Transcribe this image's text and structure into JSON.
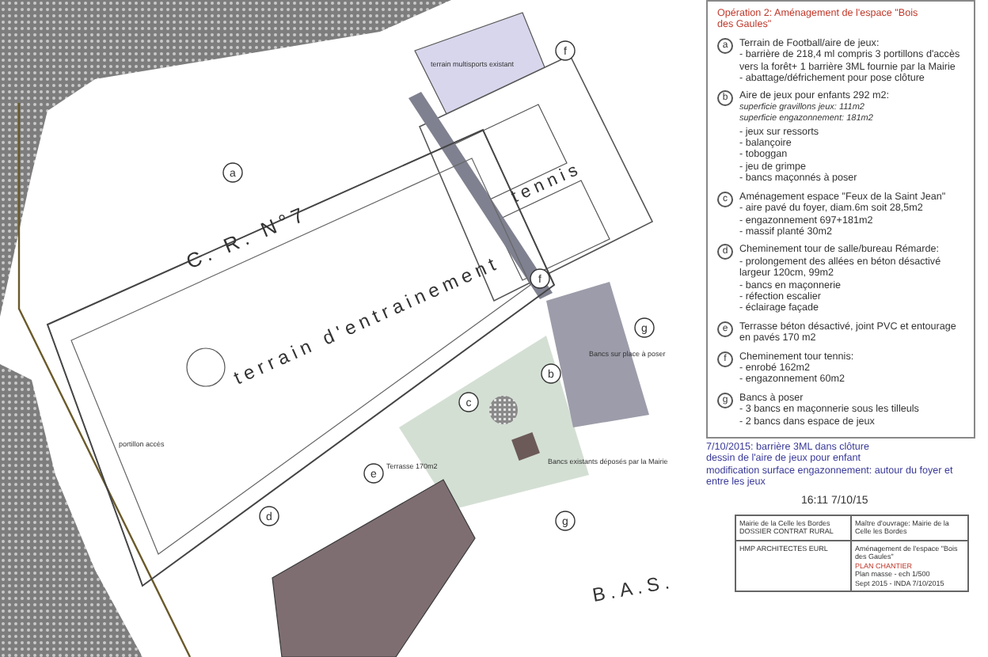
{
  "plan": {
    "labels": [
      {
        "text": "C. R. N°7",
        "kind": "road"
      },
      {
        "text": "terrain d'entrainement",
        "kind": "pitch"
      },
      {
        "text": "tennis",
        "kind": "court"
      },
      {
        "text": "B.A.S.",
        "kind": "street"
      }
    ],
    "notes": [
      "terrain multisports existant",
      "portillon accès",
      "Terrasse 170m2",
      "Bancs sur place à poser",
      "Bancs existants déposés par la Mairie"
    ],
    "markers": [
      "a",
      "f",
      "f",
      "b",
      "c",
      "d",
      "e",
      "g",
      "g"
    ]
  },
  "legend": {
    "title": "Opération 2: Aménagement de l'espace \"Bois des Gaules\"",
    "items": [
      {
        "letter": "a",
        "title": "Terrain de Football/aire de jeux:",
        "lines": [
          {
            "kind": "plain",
            "text": "- barrière de 218,4 ml compris 3 portillons d'accès vers la forêt+ 1 barrière 3ML fournie par la Mairie"
          },
          {
            "kind": "plain",
            "text": "- abattage/défrichement pour pose clôture"
          }
        ]
      },
      {
        "letter": "b",
        "title": "Aire de jeux pour enfants 292 m2:",
        "lines": [
          {
            "kind": "italic",
            "text": "superficie gravillons jeux: 111m2"
          },
          {
            "kind": "italic",
            "text": "superficie engazonnement: 181m2"
          },
          {
            "kind": "plain",
            "text": "- jeux sur ressorts"
          },
          {
            "kind": "plain",
            "text": "- balançoire"
          },
          {
            "kind": "plain",
            "text": "- toboggan"
          },
          {
            "kind": "plain",
            "text": "- jeu de grimpe"
          },
          {
            "kind": "plain",
            "text": "- bancs maçonnés à poser"
          }
        ]
      },
      {
        "letter": "c",
        "title": "Aménagement espace \"Feux de la Saint Jean\"",
        "lines": [
          {
            "kind": "plain",
            "text": "- aire pavé du foyer, diam.6m soit 28,5m2"
          },
          {
            "kind": "plain",
            "text": "- engazonnement 697+181m2"
          },
          {
            "kind": "plain",
            "text": "- massif planté 30m2"
          }
        ]
      },
      {
        "letter": "d",
        "title": "Cheminement tour de salle/bureau Rémarde:",
        "lines": [
          {
            "kind": "plain",
            "text": "- prolongement des allées en béton désactivé largeur 120cm, 99m2"
          },
          {
            "kind": "plain",
            "text": "- bancs en maçonnerie"
          },
          {
            "kind": "plain",
            "text": "- réfection escalier"
          },
          {
            "kind": "plain",
            "text": "- éclairage façade"
          }
        ]
      },
      {
        "letter": "e",
        "title": "Terrasse béton désactivé, joint PVC et entourage en pavés  170 m2"
      },
      {
        "letter": "f",
        "title": "Cheminement tour tennis:",
        "lines": [
          {
            "kind": "plain",
            "text": "- enrobé 162m2"
          },
          {
            "kind": "plain",
            "text": "- engazonnement 60m2"
          }
        ]
      },
      {
        "letter": "g",
        "title": "Bancs à poser",
        "lines": [
          {
            "kind": "plain",
            "text": "- 3 bancs en maçonnerie sous les tilleuls"
          },
          {
            "kind": "plain",
            "text": "- 2 bancs dans espace de jeux"
          }
        ]
      }
    ]
  },
  "revision": {
    "lines": [
      "7/10/2015: barrière 3ML dans clôture",
      "dessin de l'aire de jeux pour enfant",
      "modification surface engazonnement: autour du foyer et entre les jeux"
    ],
    "timestamp": "16:11 7/10/15"
  },
  "title_block": {
    "client": "Mairie de la Celle les Bordes",
    "file": "DOSSIER CONTRAT RURAL",
    "owner": "Maître d'ouvrage: Mairie de la Celle les Bordes",
    "architect": "HMP ARCHITECTES EURL",
    "project": "Aménagement de l'espace \"Bois des Gaules\"",
    "plan_type": "PLAN CHANTIER",
    "scale": "Plan masse - ech 1/500",
    "date": "Sept 2015 - INDA 7/10/2015"
  }
}
